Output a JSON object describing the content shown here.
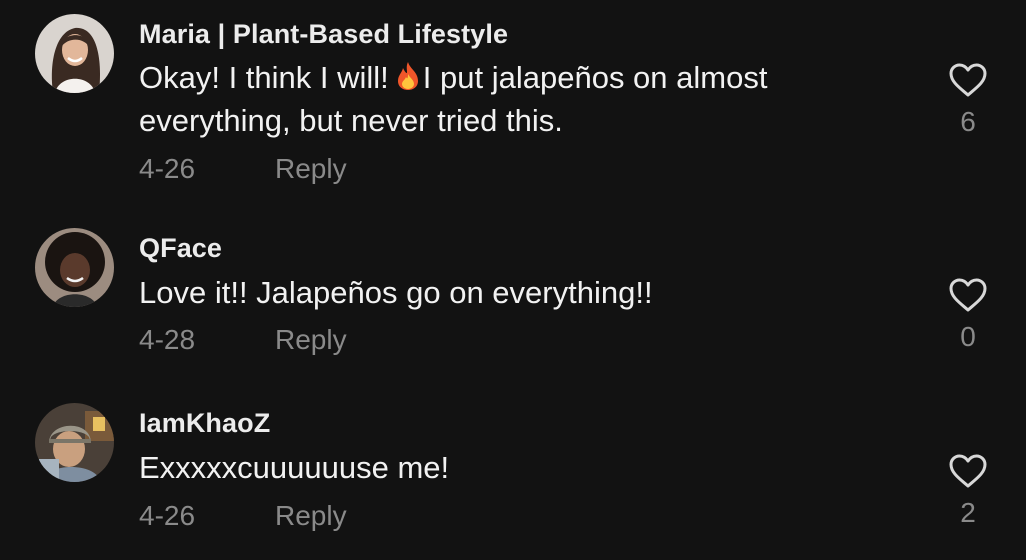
{
  "comments": [
    {
      "username": "Maria | Plant-Based Lifestyle",
      "text_before_emoji": "Okay! I think I will!",
      "emoji": "fire-emoji",
      "text_after_emoji": "I put jalapeños on almost everything, but never tried this.",
      "date": "4-26",
      "reply_label": "Reply",
      "like_count": "6",
      "avatar": "woman-long-dark-hair-avatar"
    },
    {
      "username": "QFace",
      "text": "Love it!! Jalapeños go on everything!!",
      "date": "4-28",
      "reply_label": "Reply",
      "like_count": "0",
      "avatar": "woman-curly-hair-avatar"
    },
    {
      "username": "IamKhaoZ",
      "text": "Exxxxxcuuuuuuse me!",
      "date": "4-26",
      "reply_label": "Reply",
      "like_count": "2",
      "avatar": "man-helmet-avatar"
    }
  ],
  "colors": {
    "background": "#121212",
    "primary_text": "#f2f2f2",
    "secondary_text": "#8a8a8a"
  }
}
